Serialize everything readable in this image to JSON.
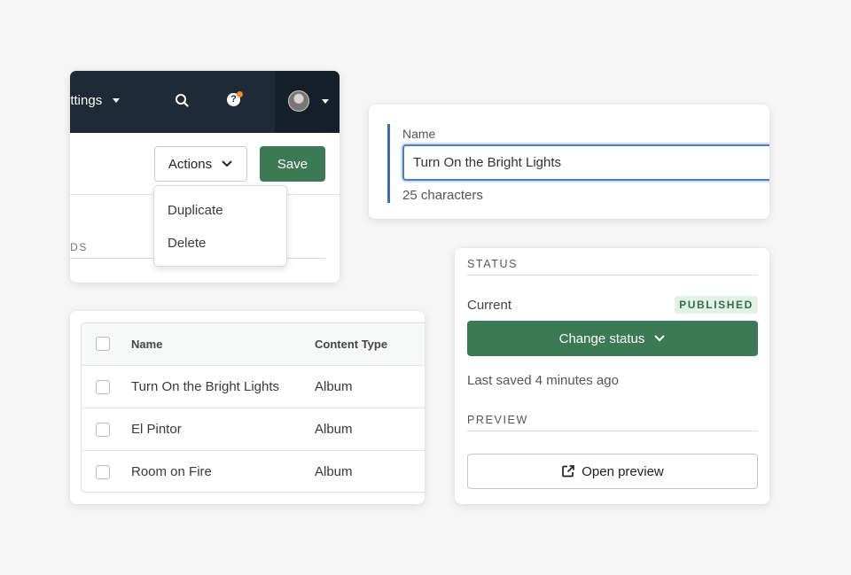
{
  "header_card": {
    "nav_settings_label": "ettings",
    "actions_label": "Actions",
    "save_label": "Save",
    "fields_label": "LDS",
    "dropdown_items": [
      "Duplicate",
      "Delete"
    ]
  },
  "name_card": {
    "label": "Name",
    "value": "Turn On the Bright Lights",
    "char_count": "25 characters"
  },
  "table_card": {
    "columns": [
      "Name",
      "Content Type"
    ],
    "rows": [
      {
        "name": "Turn On the Bright Lights",
        "type": "Album"
      },
      {
        "name": "El Pintor",
        "type": "Album"
      },
      {
        "name": "Room on Fire",
        "type": "Album"
      }
    ]
  },
  "status_card": {
    "status_heading": "STATUS",
    "current_label": "Current",
    "badge": "PUBLISHED",
    "change_status_label": "Change status",
    "last_saved": "Last saved 4 minutes ago",
    "preview_heading": "PREVIEW",
    "open_preview_label": "Open preview"
  },
  "colors": {
    "topbar": "#1e2a36",
    "primary_green": "#3b7a55",
    "focus_blue": "#4a7fc7",
    "notification_dot": "#f28b2d"
  },
  "icons": {
    "search": "search-icon",
    "help": "help-icon",
    "avatar": "avatar",
    "chevron": "chevron-down-icon",
    "external_link": "external-link-icon"
  }
}
